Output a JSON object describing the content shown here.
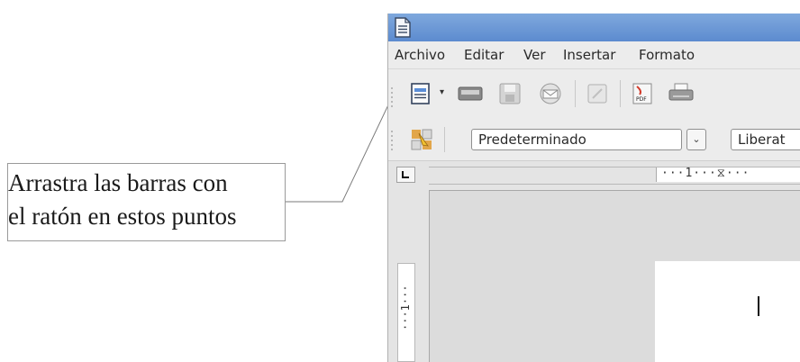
{
  "callout": {
    "line1": "Arrastra las barras con",
    "line2": "el ratón en estos puntos"
  },
  "menu": {
    "items": [
      "Archivo",
      "Editar",
      "Ver",
      "Insertar",
      "Formato"
    ]
  },
  "format_bar": {
    "paragraph_style": "Predeterminado",
    "font_name": "Liberat"
  },
  "ruler": {
    "horizontal_text": "···1···⧖···",
    "vertical_text": "···1···"
  },
  "icons": [
    "document-icon",
    "new-document-icon",
    "open-icon",
    "save-icon",
    "email-icon",
    "edit-file-icon",
    "pdf-export-icon",
    "print-icon",
    "styles-icon",
    "tab-stop-icon"
  ],
  "colors": {
    "titlebar": "#6b97d6",
    "toolbar": "#ececec",
    "document_background": "#dcdcdc"
  }
}
